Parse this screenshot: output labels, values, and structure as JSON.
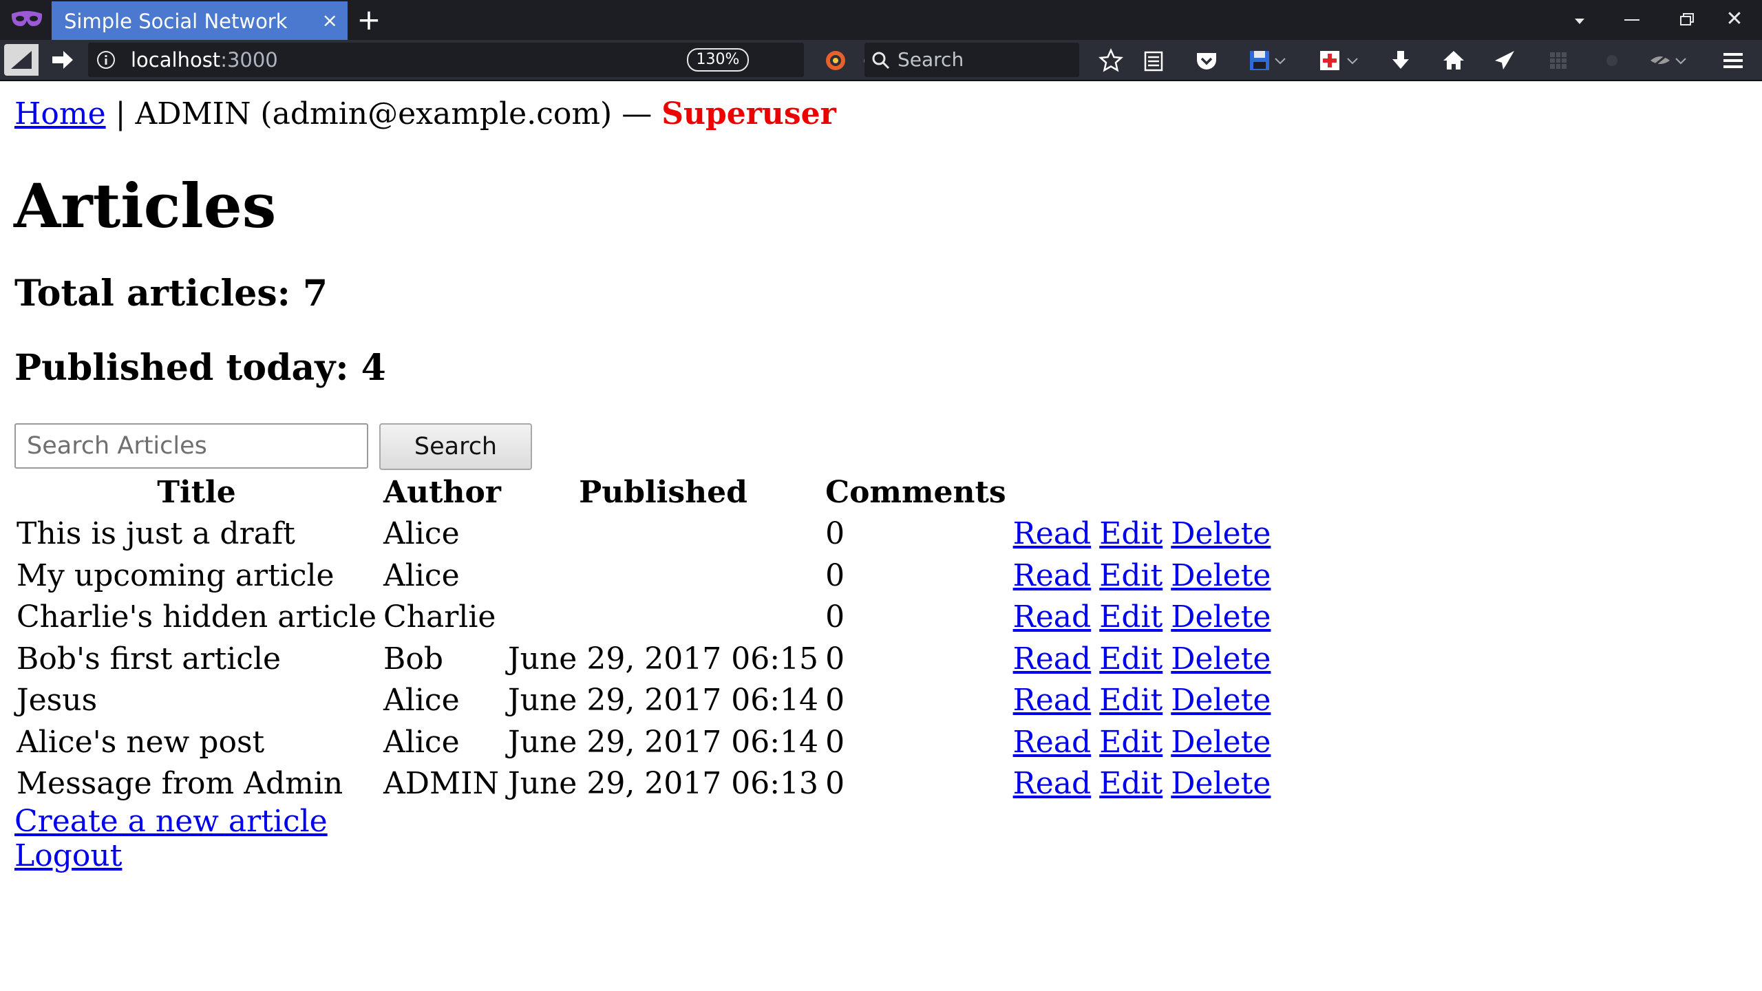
{
  "browser": {
    "tab_title": "Simple Social Network",
    "tab_close": "×",
    "new_tab": "+",
    "url_host": "localhost",
    "url_port": ":3000",
    "zoom": "130%",
    "search_placeholder": "Search",
    "accent_color": "#4a79cf"
  },
  "header": {
    "home_link": "Home",
    "separator": "|",
    "user_info": "ADMIN (admin@example.com) —",
    "role": "Superuser",
    "role_color": "#ee0000"
  },
  "page": {
    "title": "Articles",
    "total_articles": "Total articles: 7",
    "published_today": "Published today: 4"
  },
  "search": {
    "placeholder": "Search Articles",
    "button_label": "Search"
  },
  "table": {
    "headers": [
      "Title",
      "Author",
      "Published",
      "Comments"
    ],
    "rows": [
      {
        "title": "This is just a draft",
        "author": "Alice",
        "published": "",
        "comments": "0"
      },
      {
        "title": "My upcoming article",
        "author": "Alice",
        "published": "",
        "comments": "0"
      },
      {
        "title": "Charlie's hidden article",
        "author": "Charlie",
        "published": "",
        "comments": "0"
      },
      {
        "title": "Bob's first article",
        "author": "Bob",
        "published": "June 29, 2017 06:15",
        "comments": "0"
      },
      {
        "title": "Jesus",
        "author": "Alice",
        "published": "June 29, 2017 06:14",
        "comments": "0"
      },
      {
        "title": "Alice's new post",
        "author": "Alice",
        "published": "June 29, 2017 06:14",
        "comments": "0"
      },
      {
        "title": "Message from Admin",
        "author": "ADMIN",
        "published": "June 29, 2017 06:13",
        "comments": "0"
      }
    ],
    "actions": {
      "read": "Read",
      "edit": "Edit",
      "delete": "Delete"
    }
  },
  "footer": {
    "create_link": "Create a new article",
    "logout_link": "Logout"
  }
}
